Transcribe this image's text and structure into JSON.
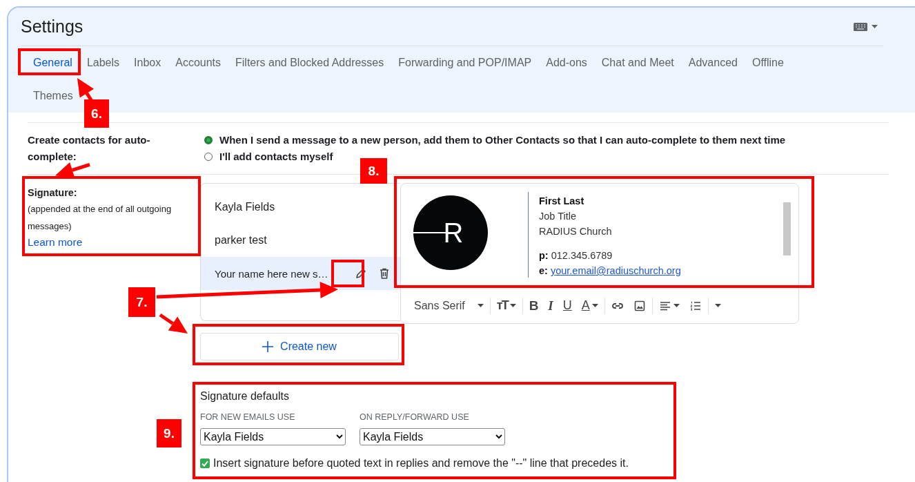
{
  "window": {
    "title": "Settings"
  },
  "tabs": [
    {
      "label": "General",
      "selected": true
    },
    {
      "label": "Labels",
      "selected": false
    },
    {
      "label": "Inbox",
      "selected": false
    },
    {
      "label": "Accounts",
      "selected": false
    },
    {
      "label": "Filters and Blocked Addresses",
      "selected": false
    },
    {
      "label": "Forwarding and POP/IMAP",
      "selected": false
    },
    {
      "label": "Add-ons",
      "selected": false
    },
    {
      "label": "Chat and Meet",
      "selected": false
    },
    {
      "label": "Advanced",
      "selected": false
    },
    {
      "label": "Offline",
      "selected": false
    },
    {
      "label": "Themes",
      "selected": false
    }
  ],
  "auto_contacts": {
    "label": "Create contacts for auto-complete:",
    "options": [
      {
        "label": "When I send a message to a new person, add them to Other Contacts so that I can auto-complete to them next time",
        "selected": true
      },
      {
        "label": "I'll add contacts myself",
        "selected": false
      }
    ]
  },
  "signature": {
    "label": "Signature:",
    "note": "(appended at the end of all outgoing messages)",
    "link": "Learn more",
    "items": [
      {
        "name": "Kayla Fields",
        "selected": false
      },
      {
        "name": "parker test",
        "selected": false
      },
      {
        "name": "Your name here new s…",
        "selected": true
      }
    ],
    "preview": {
      "logo_letter": "R",
      "name": "First Last",
      "job": "Job Title",
      "org": "RADIUS Church",
      "phone_label": "p:",
      "phone": "012.345.6789",
      "email_label": "e:",
      "email": "your.email@radiuschurch.org"
    },
    "toolbar": {
      "font": "Sans Serif",
      "items": [
        {
          "kind": "size",
          "label": "тT"
        },
        {
          "kind": "bold",
          "label": "B"
        },
        {
          "kind": "italic",
          "label": "I"
        },
        {
          "kind": "underline",
          "label": "U"
        },
        {
          "kind": "color",
          "label": "A"
        },
        {
          "kind": "link"
        },
        {
          "kind": "image"
        },
        {
          "kind": "align"
        },
        {
          "kind": "list"
        },
        {
          "kind": "more"
        }
      ]
    },
    "create_button": "Create new"
  },
  "defaults": {
    "title": "Signature defaults",
    "new_label": "FOR NEW EMAILS USE",
    "new_value": "Kayla Fields",
    "reply_label": "ON REPLY/FORWARD USE",
    "reply_value": "Kayla Fields",
    "insert_option": {
      "label": "Insert signature before quoted text in replies and remove the \"--\" line that precedes it.",
      "checked": true
    }
  },
  "annotations": [
    {
      "label": "6."
    },
    {
      "label": "7."
    },
    {
      "label": "8."
    },
    {
      "label": "9."
    }
  ]
}
